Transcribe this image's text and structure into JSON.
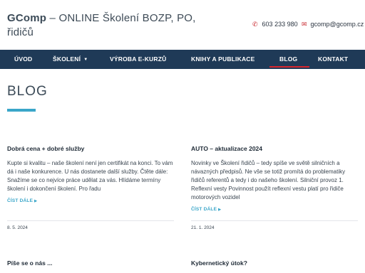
{
  "header": {
    "brand": "GComp",
    "tagline": " – ONLINE Školení BOZP, PO, řidičů",
    "phone": "603 233 980",
    "email": "gcomp@gcomp.cz",
    "phone_icon": "phone-icon",
    "email_icon": "envelope-icon"
  },
  "nav": {
    "items": [
      {
        "label": "ÚVOD"
      },
      {
        "label": "ŠKOLENÍ"
      },
      {
        "label": "VÝROBA E-KURZŮ"
      },
      {
        "label": "KNIHY A PUBLIKACE"
      },
      {
        "label": "BLOG"
      },
      {
        "label": "KONTAKT"
      }
    ],
    "active": "BLOG"
  },
  "page": {
    "title": "BLOG"
  },
  "posts": [
    {
      "title": "Dobrá cena + dobré služby",
      "excerpt": "Kupte si kvalitu – naše školení není jen certifikát na konci. To vám dá i naše konkurence. U nás dostanete další služby. Čtěte dále: Snažíme se co nejvíce práce udělat za vás. Hlídáme termíny školení i dokončení školení. Pro řadu",
      "read_more": "ČÍST DÁLE",
      "date": "8. 5. 2024"
    },
    {
      "title": "AUTO – aktualizace 2024",
      "excerpt": "Novinky ve Školení řidičů – tedy spíše ve světě silničních a návazných předpisů. Ne vše se totiž promítá do problematiky řidičů referentů a tedy i do našeho školení. Silniční provoz 1. Reflexní vesty Povinnost použít reflexní vestu platí pro řidiče motorových vozidel",
      "read_more": "ČÍST DÁLE",
      "date": "21. 1. 2024"
    },
    {
      "title": "Píše se o nás ..."
    },
    {
      "title": "Kybernetický útok?"
    }
  ],
  "colors": {
    "nav_bg": "#1f3a57",
    "accent_red": "#d6262e",
    "accent_blue": "#3aa6c9"
  }
}
